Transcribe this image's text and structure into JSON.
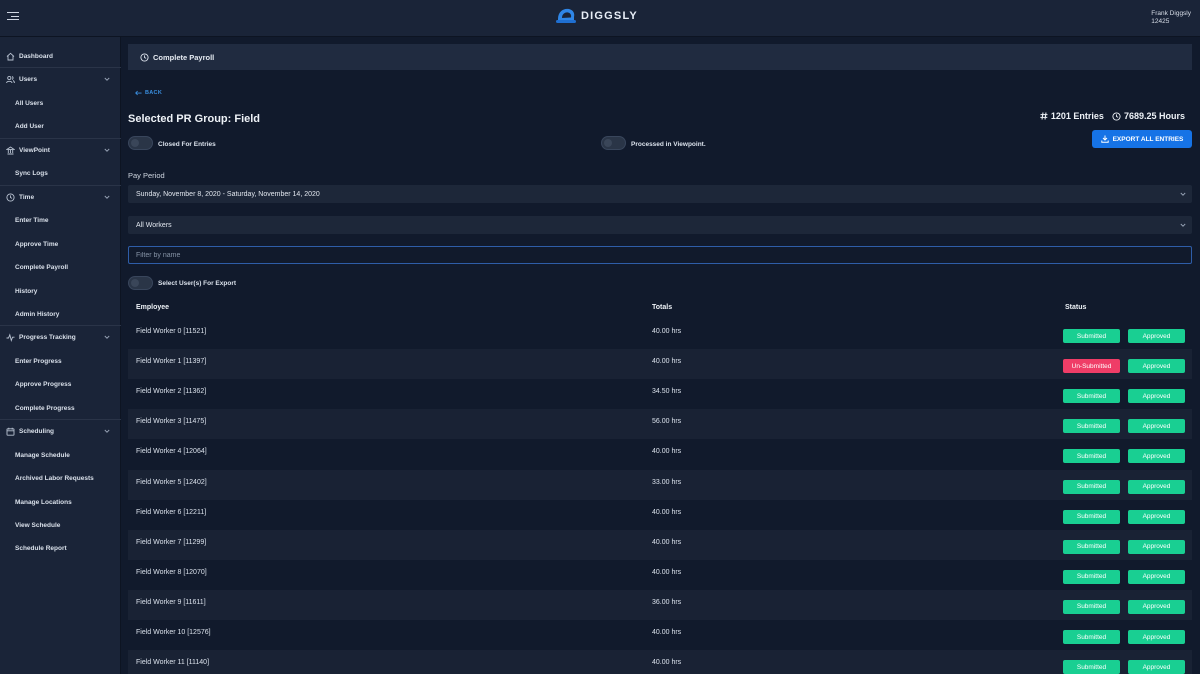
{
  "app": {
    "brand": "DIGGSLY",
    "user_name": "Frank Diggsly",
    "user_id": "12425"
  },
  "sidebar": {
    "items": [
      {
        "label": "Dashboard",
        "kind": "section",
        "icon": "home-icon",
        "chevron": false
      },
      {
        "label": "Users",
        "kind": "section",
        "icon": "users-icon",
        "chevron": true
      },
      {
        "label": "All Users",
        "kind": "sub"
      },
      {
        "label": "Add User",
        "kind": "sub"
      },
      {
        "label": "ViewPoint",
        "kind": "section",
        "icon": "bank-icon",
        "chevron": true
      },
      {
        "label": "Sync Logs",
        "kind": "sub"
      },
      {
        "label": "Time",
        "kind": "section",
        "icon": "clock-icon",
        "chevron": true
      },
      {
        "label": "Enter Time",
        "kind": "sub"
      },
      {
        "label": "Approve Time",
        "kind": "sub"
      },
      {
        "label": "Complete Payroll",
        "kind": "sub"
      },
      {
        "label": "History",
        "kind": "sub"
      },
      {
        "label": "Admin History",
        "kind": "sub"
      },
      {
        "label": "Progress Tracking",
        "kind": "section",
        "icon": "activity-icon",
        "chevron": true
      },
      {
        "label": "Enter Progress",
        "kind": "sub"
      },
      {
        "label": "Approve Progress",
        "kind": "sub"
      },
      {
        "label": "Complete Progress",
        "kind": "sub"
      },
      {
        "label": "Scheduling",
        "kind": "section",
        "icon": "calendar-icon",
        "chevron": true
      },
      {
        "label": "Manage Schedule",
        "kind": "sub"
      },
      {
        "label": "Archived Labor Requests",
        "kind": "sub"
      },
      {
        "label": "Manage Locations",
        "kind": "sub"
      },
      {
        "label": "View Schedule",
        "kind": "sub"
      },
      {
        "label": "Schedule Report",
        "kind": "sub"
      }
    ]
  },
  "header": {
    "title": "Complete Payroll"
  },
  "page": {
    "back_label": "BACK",
    "group_title": "Selected PR Group: Field",
    "entries": "1201 Entries",
    "hours": "7689.25 Hours",
    "toggle_closed": "Closed For Entries",
    "toggle_processed": "Processed in Viewpoint.",
    "export_label": "EXPORT ALL ENTRIES",
    "pay_period_label": "Pay Period",
    "pay_period_value": "Sunday, November 8, 2020 - Saturday, November 14, 2020",
    "workers_value": "All Workers",
    "filter_placeholder": "Filter by name",
    "select_export_label": "Select User(s) For Export"
  },
  "table": {
    "headers": {
      "employee": "Employee",
      "totals": "Totals",
      "status": "Status"
    },
    "rows": [
      {
        "employee": "Field Worker 0 [11521]",
        "total": "40.00 hrs",
        "status": "Submitted",
        "approval": "Approved"
      },
      {
        "employee": "Field Worker 1 [11397]",
        "total": "40.00 hrs",
        "status": "Un-Submitted",
        "approval": "Approved"
      },
      {
        "employee": "Field Worker 2 [11362]",
        "total": "34.50 hrs",
        "status": "Submitted",
        "approval": "Approved"
      },
      {
        "employee": "Field Worker 3 [11475]",
        "total": "56.00 hrs",
        "status": "Submitted",
        "approval": "Approved"
      },
      {
        "employee": "Field Worker 4 [12064]",
        "total": "40.00 hrs",
        "status": "Submitted",
        "approval": "Approved"
      },
      {
        "employee": "Field Worker 5 [12402]",
        "total": "33.00 hrs",
        "status": "Submitted",
        "approval": "Approved"
      },
      {
        "employee": "Field Worker 6 [12211]",
        "total": "40.00 hrs",
        "status": "Submitted",
        "approval": "Approved"
      },
      {
        "employee": "Field Worker 7 [11299]",
        "total": "40.00 hrs",
        "status": "Submitted",
        "approval": "Approved"
      },
      {
        "employee": "Field Worker 8 [12070]",
        "total": "40.00 hrs",
        "status": "Submitted",
        "approval": "Approved"
      },
      {
        "employee": "Field Worker 9 [11611]",
        "total": "36.00 hrs",
        "status": "Submitted",
        "approval": "Approved"
      },
      {
        "employee": "Field Worker 10 [12576]",
        "total": "40.00 hrs",
        "status": "Submitted",
        "approval": "Approved"
      },
      {
        "employee": "Field Worker 11 [11140]",
        "total": "40.00 hrs",
        "status": "Submitted",
        "approval": "Approved"
      }
    ]
  },
  "colors": {
    "accent": "#1673e6",
    "submitted": "#19cf92",
    "unsubmitted": "#ef3d67"
  }
}
